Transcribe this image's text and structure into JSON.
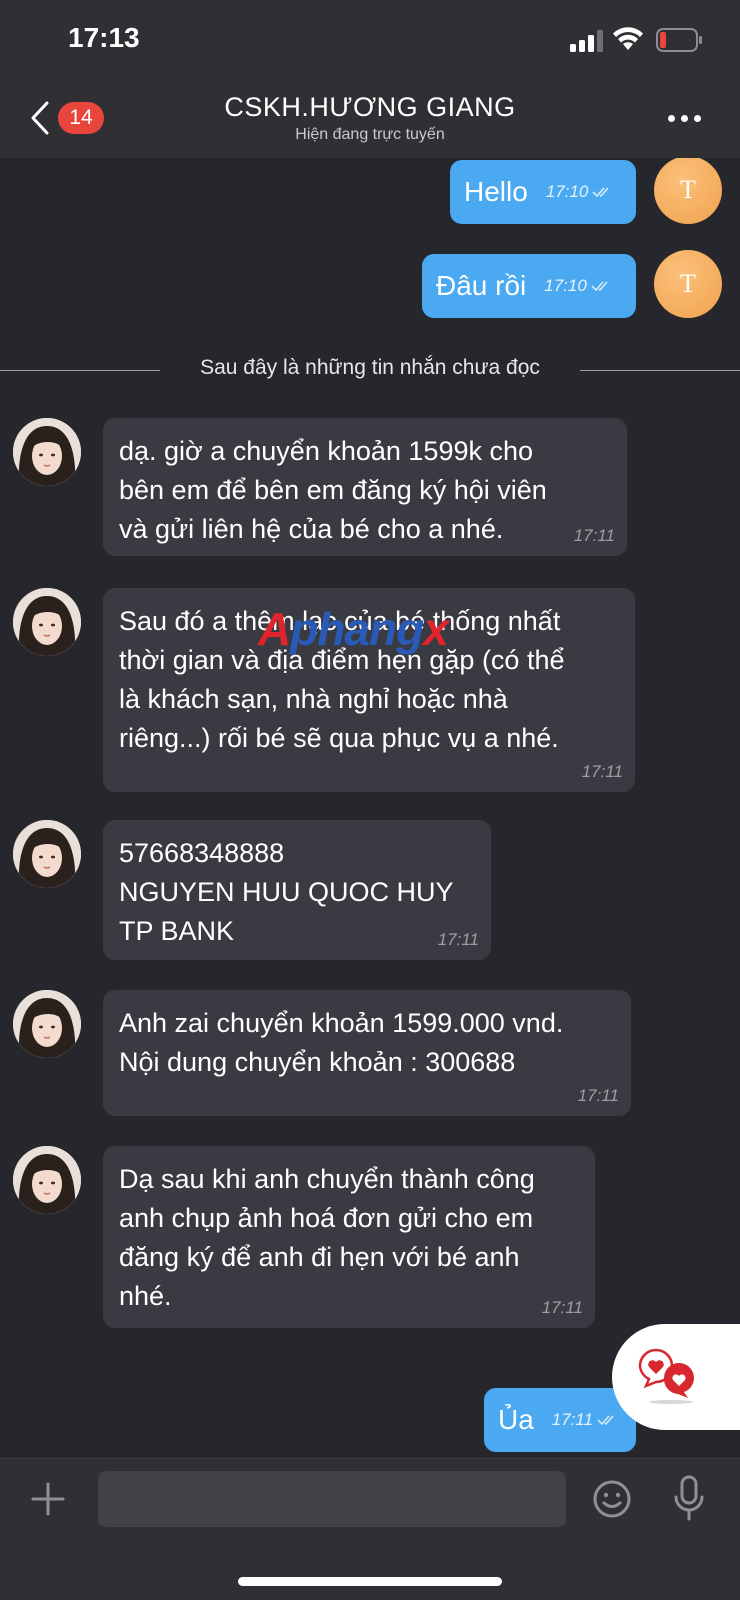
{
  "status_bar": {
    "time": "17:13"
  },
  "header": {
    "back_count": "14",
    "title": "CSKH.HƯƠNG GIANG",
    "subtitle": "Hiện đang trực tuyến"
  },
  "outgoing_top": [
    {
      "text": "Hello",
      "time": "17:10",
      "avatar": "T"
    },
    {
      "text": "Đâu rồi",
      "time": "17:10",
      "avatar": "T"
    }
  ],
  "unread_divider": "Sau đây là những tin nhắn chưa đọc",
  "incoming": [
    {
      "text": "dạ. giờ a chuyển khoản 1599k  cho\nbên em để bên em đăng ký hội viên\nvà  gửi liên hệ của bé cho a nhé.",
      "time": "17:11"
    },
    {
      "text": "Sau đó a thêm lạc của bé  thống nhất\nthời gian và địa điểm hẹn gặp (có thể\nlà khách sạn, nhà nghỉ hoặc nhà\nriêng...) rối bé sẽ qua phục vụ a nhé.",
      "time": "17:11"
    },
    {
      "text": "57668348888\nNGUYEN HUU QUOC HUY\nTP BANK",
      "time": "17:11"
    },
    {
      "text": "Anh zai chuyển khoản 1599.000 vnd.\nNội dung chuyển khoản : 300688",
      "time": "17:11"
    },
    {
      "text": "Dạ sau khi anh chuyển thành công\nanh chụp ảnh hoá đơn gửi cho em\nđăng ký để anh đi hẹn với bé anh\nnhé.",
      "time": "17:11"
    }
  ],
  "outgoing_bottom": {
    "text": "Ủa",
    "time": "17:11"
  },
  "watermark": {
    "part1": "A",
    "part2": "phang",
    "part3": "x"
  },
  "composer": {
    "placeholder": ""
  },
  "colors": {
    "outgoing_bubble": "#4aa9f0",
    "incoming_bubble": "#3a3b42",
    "background": "#26272c",
    "badge": "#e8463c"
  }
}
